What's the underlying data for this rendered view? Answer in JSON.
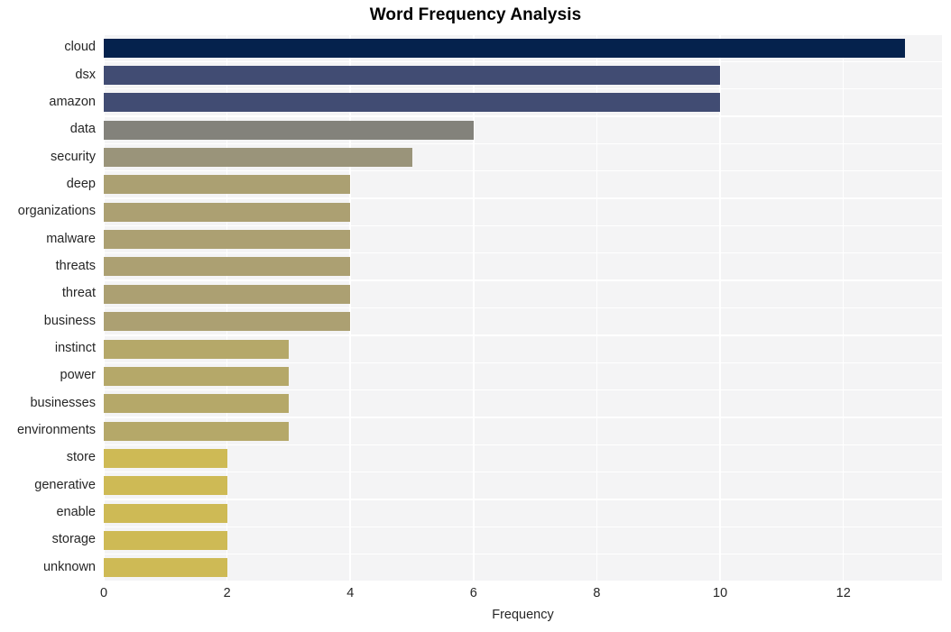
{
  "chart_data": {
    "type": "bar",
    "orientation": "horizontal",
    "title": "Word Frequency Analysis",
    "xlabel": "Frequency",
    "ylabel": "",
    "categories": [
      "cloud",
      "dsx",
      "amazon",
      "data",
      "security",
      "deep",
      "organizations",
      "malware",
      "threats",
      "threat",
      "business",
      "instinct",
      "power",
      "businesses",
      "environments",
      "store",
      "generative",
      "enable",
      "storage",
      "unknown"
    ],
    "values": [
      13,
      10,
      10,
      6,
      5,
      4,
      4,
      4,
      4,
      4,
      4,
      3,
      3,
      3,
      3,
      2,
      2,
      2,
      2,
      2
    ],
    "bar_colors": [
      "#05224d",
      "#414c73",
      "#414c73",
      "#83827b",
      "#9a947a",
      "#ab a072",
      "#aca072",
      "#aca072",
      "#aca072",
      "#aca072",
      "#aca072",
      "#b5a869",
      "#b5a869",
      "#b5a869",
      "#b5a869",
      "#ceba55",
      "#ceba55",
      "#ceba55",
      "#ceba55",
      "#ceba55"
    ],
    "xlim": [
      0,
      13.6
    ],
    "xticks": [
      0,
      2,
      4,
      6,
      8,
      10,
      12
    ],
    "xticklabels": [
      "0",
      "2",
      "4",
      "6",
      "8",
      "10",
      "12"
    ],
    "grid": true,
    "grid_color": "#ffffff",
    "plot_background": "#f4f4f5",
    "figure_background": "#ffffff",
    "legend": null,
    "legend_position": "none"
  }
}
